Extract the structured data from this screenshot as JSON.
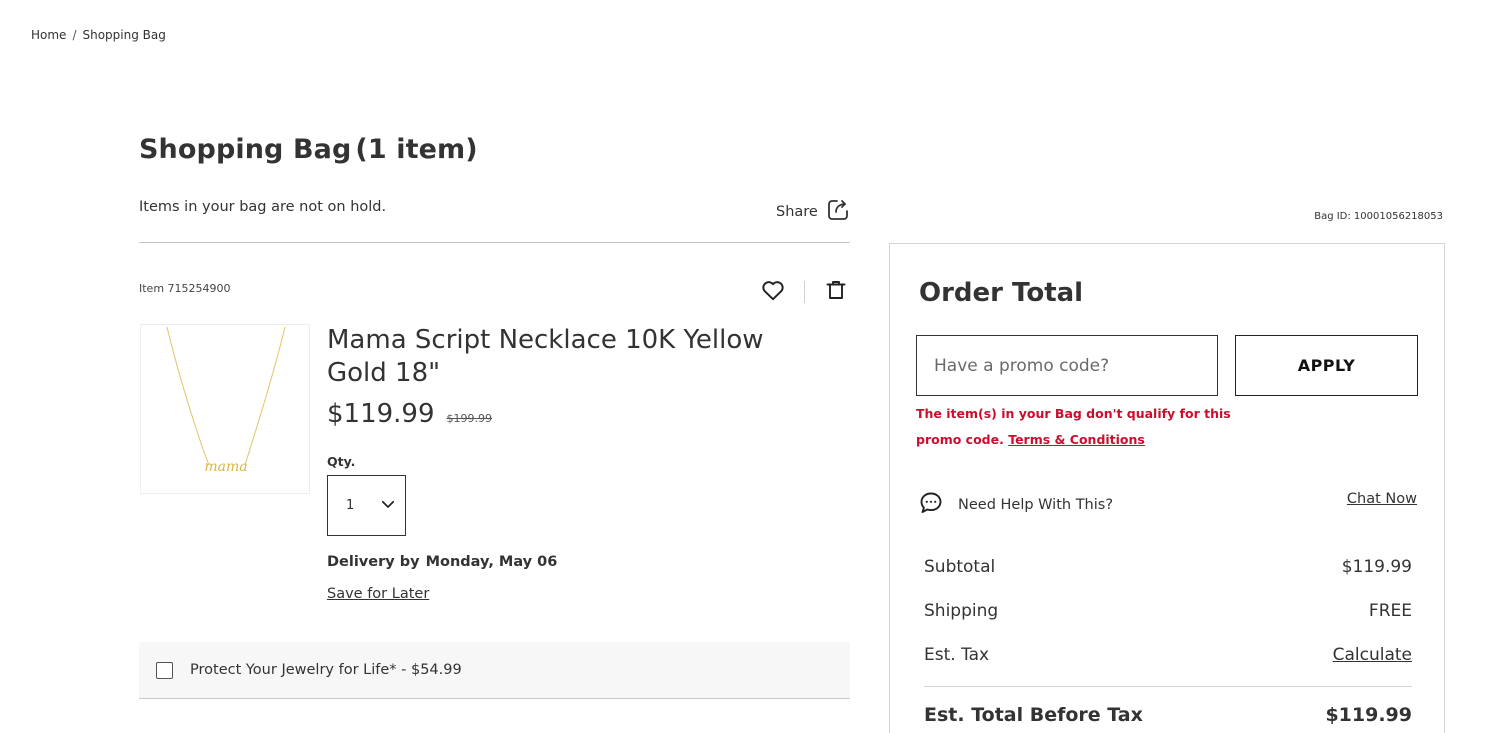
{
  "breadcrumb": {
    "home": "Home",
    "separator": "/",
    "current": "Shopping Bag"
  },
  "page": {
    "title": "Shopping Bag",
    "item_count": "(1 item)",
    "hold_note": "Items in your bag are not on hold.",
    "share_label": "Share",
    "bag_id": "Bag ID: 10001056218053"
  },
  "item": {
    "item_number": "Item 715254900",
    "name": "Mama Script Necklace 10K Yellow Gold 18\"",
    "price_now": "$119.99",
    "price_was": "$199.99",
    "qty_label": "Qty.",
    "qty_value": "1",
    "delivery_label": "Delivery by",
    "delivery_date": "Monday, May 06",
    "save_for_later": "Save for Later",
    "image_script_text": "mama"
  },
  "protection": {
    "label": "Protect Your Jewelry for Life* - $54.99",
    "checked": false
  },
  "order": {
    "title": "Order Total",
    "promo_placeholder": "Have a promo code?",
    "apply_label": "APPLY",
    "promo_error": "The item(s) in your Bag don't qualify for this promo code.",
    "terms_label": "Terms & Conditions",
    "help_text": "Need Help With This?",
    "chat_now": "Chat Now",
    "subtotal_label": "Subtotal",
    "subtotal_value": "$119.99",
    "shipping_label": "Shipping",
    "shipping_value": "FREE",
    "tax_label": "Est. Tax",
    "tax_value": "Calculate",
    "total_label": "Est. Total Before Tax",
    "total_value": "$119.99"
  },
  "colors": {
    "error": "#c8102e",
    "text": "#333333",
    "border": "#d4d4d4",
    "gold": "#d9b64a"
  },
  "icons": {
    "share": "share-icon",
    "wishlist": "heart-icon",
    "remove": "trash-icon",
    "qty": "chevron-down-icon",
    "help": "chat-bubble-icon"
  }
}
